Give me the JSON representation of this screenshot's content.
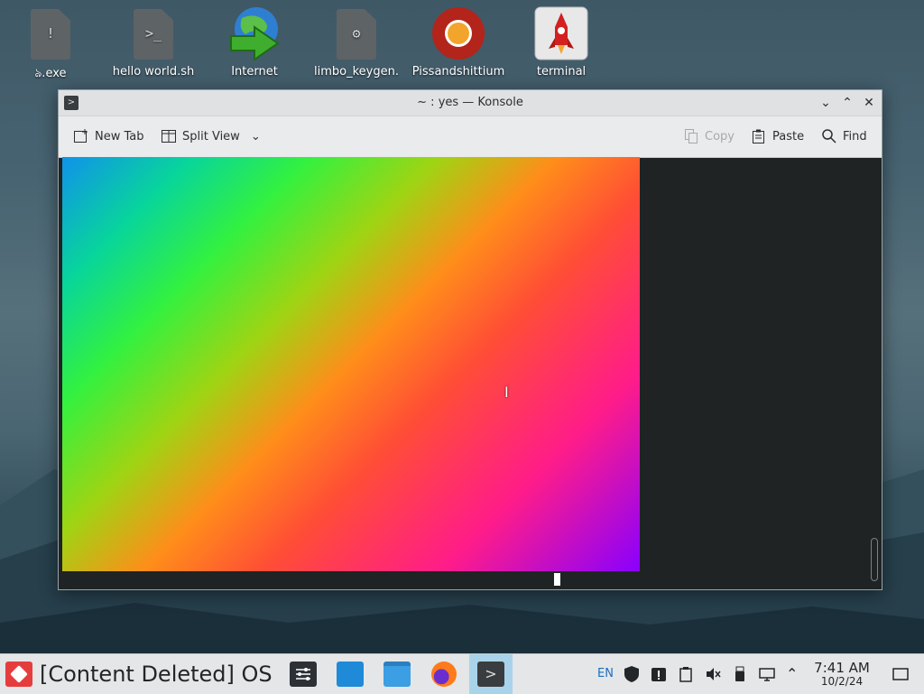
{
  "desktop": {
    "icons": [
      {
        "label": "ঌ.exe",
        "icon": "exe-file-icon",
        "glyph": "!"
      },
      {
        "label": "hello world.sh",
        "icon": "script-file-icon",
        "glyph": ">_"
      },
      {
        "label": "Internet",
        "icon": "globe-download-icon"
      },
      {
        "label": "limbo_keygen.",
        "icon": "executable-gear-icon",
        "glyph": "⚙"
      },
      {
        "label": "Pissandshittium",
        "icon": "browser-icon"
      },
      {
        "label": "terminal",
        "icon": "rocket-icon"
      }
    ]
  },
  "window": {
    "title": "~ : yes — Konsole",
    "toolbar": {
      "new_tab": "New Tab",
      "split_view": "Split View",
      "copy": "Copy",
      "paste": "Paste",
      "find": "Find"
    },
    "terminal_cursor_glyph": "I"
  },
  "taskbar": {
    "os_label": "[Content Deleted] OS",
    "lang": "EN",
    "time": "7:41 AM",
    "date": "10/2/24"
  },
  "colors": {
    "accent": "#a9d3ea",
    "os_button": "#e53d3d",
    "terminal_bg": "#1f2323"
  }
}
